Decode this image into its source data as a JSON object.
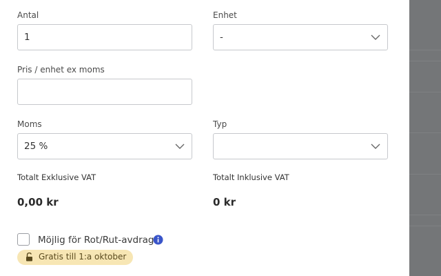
{
  "form": {
    "quantity": {
      "label": "Antal",
      "value": "1"
    },
    "unit": {
      "label": "Enhet",
      "value": "-"
    },
    "price": {
      "label": "Pris / enhet ex moms",
      "value": ""
    },
    "vat": {
      "label": "Moms",
      "value": "25 %"
    },
    "type": {
      "label": "Typ",
      "value": ""
    }
  },
  "totals": {
    "excl_label": "Totalt Exklusive VAT",
    "excl_value": "0,00 kr",
    "incl_label": "Totalt Inklusive VAT",
    "incl_value": "0 kr"
  },
  "rot_rut": {
    "label": "Möjlig för Rot/Rut-avdrag",
    "checked": false,
    "info_icon": "info-circle-icon",
    "badge_icon": "unlock-icon",
    "badge": "Gratis till 1:a oktober"
  },
  "colors": {
    "info_blue": "#3a55c9",
    "badge_bg": "#f7e6b4",
    "overlay": "#747678"
  }
}
